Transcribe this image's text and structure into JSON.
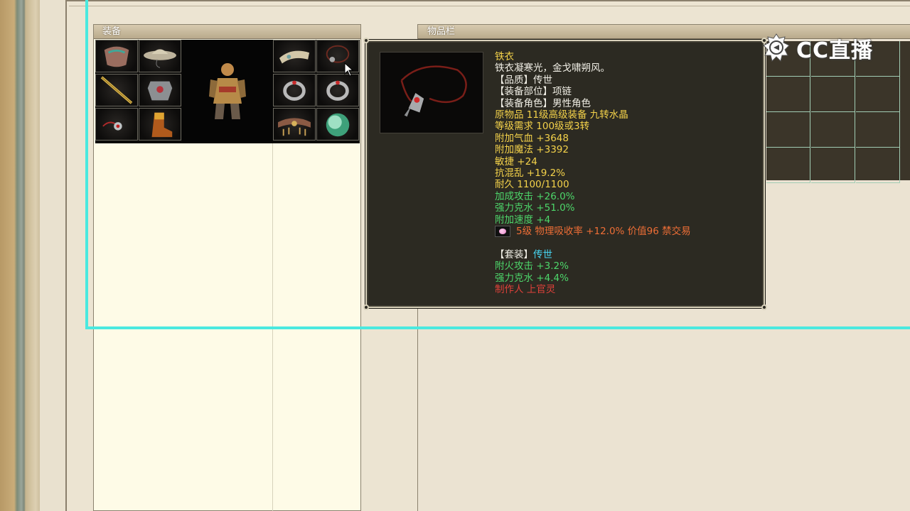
{
  "equipment_panel": {
    "title": "装备"
  },
  "item_panel": {
    "title": "物品栏"
  },
  "logo": {
    "text": "CC直播",
    "icon": "cc-logo-icon"
  },
  "equipment_slots": [
    {
      "name": "slot-armor-top-left",
      "icon": "armor-icon"
    },
    {
      "name": "slot-hat",
      "icon": "hat-icon"
    },
    {
      "name": "slot-weapon",
      "icon": "staff-icon"
    },
    {
      "name": "slot-chest",
      "icon": "chestplate-icon"
    },
    {
      "name": "slot-amulet",
      "icon": "amulet-icon"
    },
    {
      "name": "slot-boots",
      "icon": "boots-icon"
    },
    {
      "name": "slot-bracer",
      "icon": "bracer-icon"
    },
    {
      "name": "slot-necklace",
      "icon": "necklace-icon"
    },
    {
      "name": "slot-ring-left",
      "icon": "ring-icon"
    },
    {
      "name": "slot-ring-right",
      "icon": "ring-icon"
    },
    {
      "name": "slot-belt",
      "icon": "belt-icon"
    },
    {
      "name": "slot-jade",
      "icon": "jade-orb-icon"
    }
  ],
  "tooltip": {
    "name": "铁衣",
    "description": "铁衣凝寒光，金戈啸朔风。",
    "quality": "【品质】传世",
    "slot": "【装备部位】项链",
    "role": "【装备角色】男性角色",
    "origin": "原物品 11级高级装备 九转水晶",
    "level_req": "等级需求 100级或3转",
    "hp": "附加气血 +3648",
    "mp": "附加魔法 +3392",
    "agility": "敏捷 +24",
    "anti_chaos": "抗混乱 +19.2%",
    "durability": "耐久 1100/1100",
    "bonus_attack": "加成攻击 +26.0%",
    "strong_water": "强力克水 +51.0%",
    "bonus_speed": "附加速度 +4",
    "gem_line": "5级 物理吸收率 +12.0% 价值96 禁交易",
    "set_label": "【套装】",
    "set_name": "传世",
    "set_fire": "附火攻击 +3.2%",
    "set_water": "强力克水 +4.4%",
    "maker": "制作人 上官灵"
  },
  "colors": {
    "gold": "#f4d24a",
    "white": "#f1efe6",
    "green": "#4dd66a",
    "orange": "#ee6e36",
    "cyan": "#47d6f3",
    "red": "#e0413a",
    "selection": "#4ae9df"
  }
}
